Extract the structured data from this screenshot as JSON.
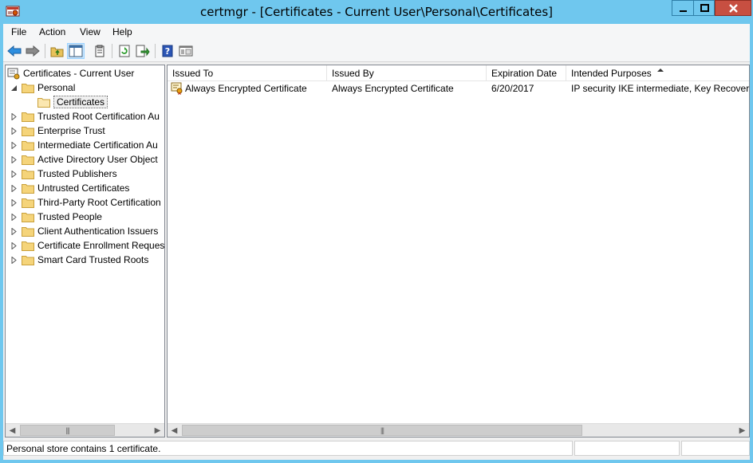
{
  "window": {
    "title": "certmgr - [Certificates - Current User\\Personal\\Certificates]",
    "icon": "certificate-manager-icon",
    "buttons": [
      "minimize-icon",
      "maximize-icon",
      "close-icon"
    ]
  },
  "menu": {
    "items": [
      "File",
      "Action",
      "View",
      "Help"
    ]
  },
  "toolbar": {
    "buttons": [
      "back-arrow-icon",
      "forward-arrow-icon",
      "up-folder-icon",
      "show-hide-console-tree-icon",
      "properties-icon",
      "refresh-icon",
      "export-list-icon",
      "help-icon",
      "mmc-icon"
    ],
    "active": "show-hide-console-tree-icon"
  },
  "tree": {
    "root": "Certificates - Current User",
    "personal": "Personal",
    "selected_child": "Certificates",
    "stores": [
      "Trusted Root Certification Au",
      "Enterprise Trust",
      "Intermediate Certification Au",
      "Active Directory User Object",
      "Trusted Publishers",
      "Untrusted Certificates",
      "Third-Party Root Certification",
      "Trusted People",
      "Client Authentication Issuers",
      "Certificate Enrollment Reques",
      "Smart Card Trusted Roots"
    ]
  },
  "list": {
    "columns": [
      "Issued To",
      "Issued By",
      "Expiration Date",
      "Intended Purposes"
    ],
    "sorted_column": "Intended Purposes",
    "rows": [
      {
        "issued_to": "Always Encrypted Certificate",
        "issued_by": "Always Encrypted Certificate",
        "expiration": "6/20/2017",
        "purposes": "IP security IKE intermediate, Key Recovery"
      }
    ]
  },
  "status": {
    "text": "Personal store contains 1 certificate."
  },
  "colors": {
    "title_bar": "#6fc7ee",
    "close_button": "#c74f41",
    "selection": "#cce8ff"
  }
}
